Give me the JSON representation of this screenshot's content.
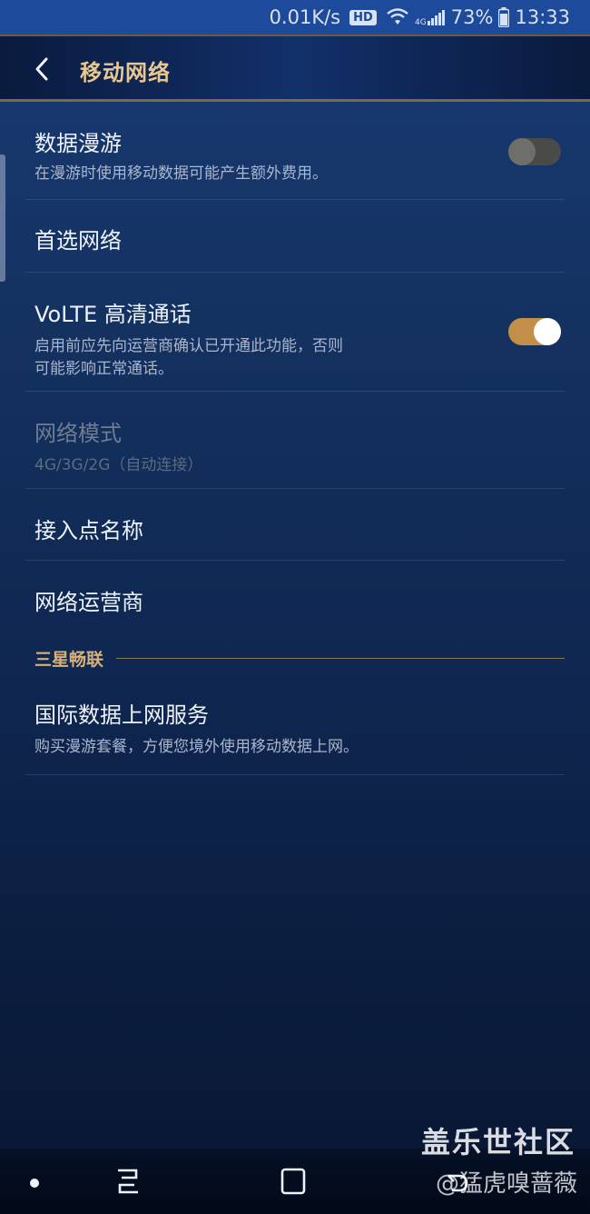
{
  "status_bar": {
    "speed": "0.01K/s",
    "hd": "HD",
    "network": "4G",
    "battery": "73%",
    "time": "13:33"
  },
  "header": {
    "title": "移动网络",
    "back_icon": "chevron-left-icon"
  },
  "settings": {
    "data_roaming": {
      "title": "数据漫游",
      "subtitle": "在漫游时使用移动数据可能产生额外费用。",
      "enabled": false
    },
    "preferred_network": {
      "title": "首选网络"
    },
    "volte": {
      "title": "VoLTE 高清通话",
      "subtitle_line1": "启用前应先向运营商确认已开通此功能，否则",
      "subtitle_line2": "可能影响正常通话。",
      "enabled": true
    },
    "network_mode": {
      "title": "网络模式",
      "subtitle": "4G/3G/2G（自动连接）",
      "disabled": true
    },
    "apn": {
      "title": "接入点名称"
    },
    "operator": {
      "title": "网络运营商"
    },
    "section_samsung": {
      "label": "三星畅联"
    },
    "intl_data": {
      "title": "国际数据上网服务",
      "subtitle": "购买漫游套餐，方便您境外使用移动数据上网。"
    }
  },
  "watermark": {
    "site": "盖乐世社区",
    "user": "@猛虎嗅蔷薇"
  },
  "colors": {
    "accent_gold": "#c28f48",
    "title_gold": "#e8c890",
    "background": "#14315f"
  }
}
